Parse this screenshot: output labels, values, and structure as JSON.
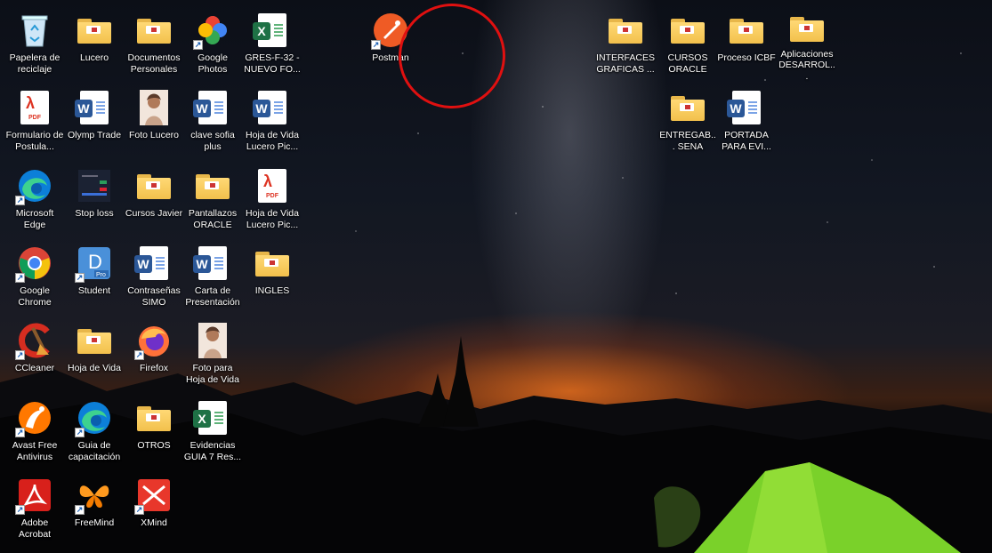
{
  "desktop": {
    "icons": [
      {
        "label": "Papelera de reciclaje",
        "icon": "recycle-bin-icon",
        "shortcut": false
      },
      {
        "label": "Lucero",
        "icon": "folder-icon",
        "shortcut": false
      },
      {
        "label": "Documentos Personales",
        "icon": "folder-icon",
        "shortcut": false
      },
      {
        "label": "Google Photos",
        "icon": "google-photos-icon",
        "shortcut": true
      },
      {
        "label": "GRES-F-32 - NUEVO FO...",
        "icon": "excel-icon",
        "shortcut": false
      },
      {
        "label": "Postman",
        "icon": "postman-icon",
        "shortcut": true
      },
      {
        "label": "INTERFACES GRAFICAS ...",
        "icon": "folder-icon",
        "shortcut": false
      },
      {
        "label": "CURSOS ORACLE",
        "icon": "folder-icon",
        "shortcut": false
      },
      {
        "label": "Proceso ICBF",
        "icon": "folder-icon",
        "shortcut": false
      },
      {
        "label": "Aplicaciones DESARROL...",
        "icon": "folder-icon",
        "shortcut": false
      },
      {
        "label": "Formulario de Postula...",
        "icon": "pdf-icon",
        "shortcut": false
      },
      {
        "label": "Olymp Trade",
        "icon": "word-icon",
        "shortcut": false
      },
      {
        "label": "Foto Lucero",
        "icon": "photo-icon",
        "shortcut": false
      },
      {
        "label": "clave sofia plus",
        "icon": "word-icon",
        "shortcut": false
      },
      {
        "label": "Hoja de Vida Lucero Pic...",
        "icon": "word-icon",
        "shortcut": false
      },
      {
        "label": "ENTREGAB... SENA",
        "icon": "folder-icon",
        "shortcut": false
      },
      {
        "label": "PORTADA PARA EVI...",
        "icon": "word-icon",
        "shortcut": false
      },
      {
        "label": "Microsoft Edge",
        "icon": "edge-icon",
        "shortcut": true
      },
      {
        "label": "Stop loss",
        "icon": "screenshot-icon",
        "shortcut": false
      },
      {
        "label": "Cursos Javier",
        "icon": "folder-icon",
        "shortcut": false
      },
      {
        "label": "Pantallazos ORACLE",
        "icon": "folder-icon",
        "shortcut": false
      },
      {
        "label": "Hoja de Vida Lucero Pic...",
        "icon": "pdf-icon",
        "shortcut": false
      },
      {
        "label": "Google Chrome",
        "icon": "chrome-icon",
        "shortcut": true
      },
      {
        "label": "Student",
        "icon": "student-icon",
        "shortcut": true
      },
      {
        "label": "Contraseñas SIMO",
        "icon": "word-icon",
        "shortcut": false
      },
      {
        "label": "Carta de Presentación",
        "icon": "word-icon",
        "shortcut": false
      },
      {
        "label": "INGLES",
        "icon": "folder-icon",
        "shortcut": false
      },
      {
        "label": "CCleaner",
        "icon": "ccleaner-icon",
        "shortcut": true
      },
      {
        "label": "Hoja de Vida",
        "icon": "folder-icon",
        "shortcut": false
      },
      {
        "label": "Firefox",
        "icon": "firefox-icon",
        "shortcut": true
      },
      {
        "label": "Foto para Hoja de Vida",
        "icon": "photo-icon",
        "shortcut": false
      },
      {
        "label": "Avast Free Antivirus",
        "icon": "avast-icon",
        "shortcut": true
      },
      {
        "label": "Guia de capacitación",
        "icon": "edge-icon",
        "shortcut": true
      },
      {
        "label": "OTROS",
        "icon": "folder-icon",
        "shortcut": false
      },
      {
        "label": "Evidencias GUIA 7 Res...",
        "icon": "excel-icon",
        "shortcut": false
      },
      {
        "label": "Adobe Acrobat",
        "icon": "acrobat-icon",
        "shortcut": true
      },
      {
        "label": "FreeMind",
        "icon": "freemind-icon",
        "shortcut": true
      },
      {
        "label": "XMind",
        "icon": "xmind-icon",
        "shortcut": true
      }
    ]
  },
  "colors": {
    "annotation": "#e01010",
    "folder": "#f2c04c",
    "word": "#2b5797",
    "excel": "#1e7145"
  }
}
